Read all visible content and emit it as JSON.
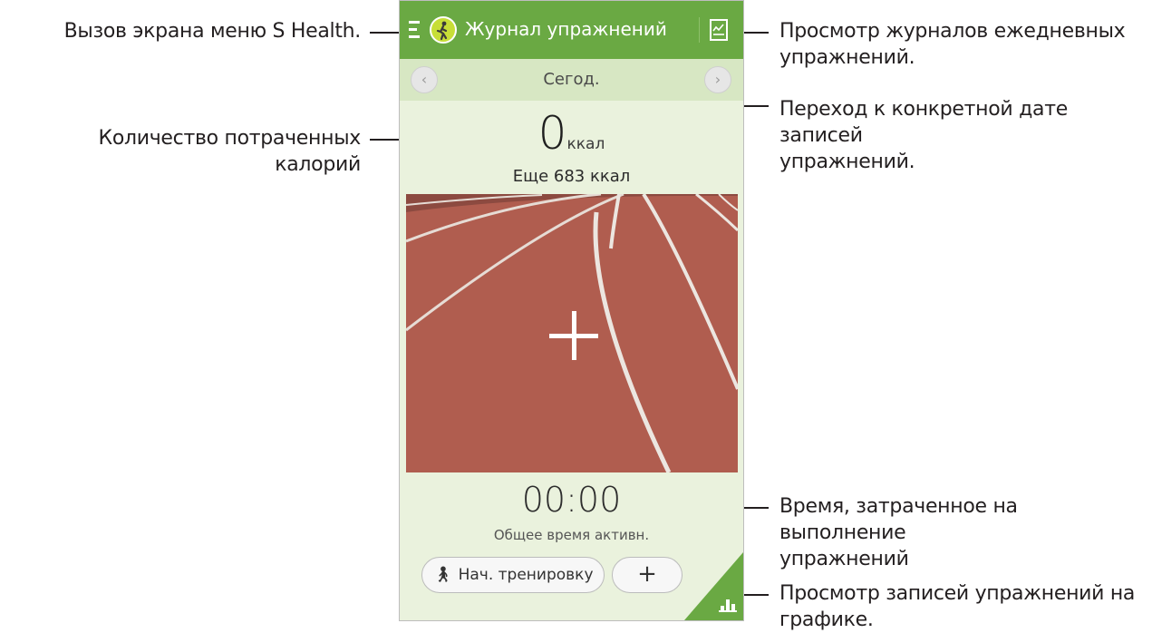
{
  "callouts": {
    "menu": "Вызов экрана меню S Health.",
    "daily_logs": [
      "Просмотр журналов ежедневных",
      "упражнений."
    ],
    "date_nav": [
      "Переход к конкретной дате записей",
      "упражнений."
    ],
    "calories": "Количество потраченных калорий",
    "time_spent": [
      "Время, затраченное на выполнение",
      "упражнений"
    ],
    "graph": [
      "Просмотр записей упражнений на",
      "графике."
    ]
  },
  "app": {
    "title": "Журнал упражнений",
    "menu_icon": "hamburger-icon",
    "logo_icon": "walker-icon",
    "log_icon": "chart-log-icon",
    "accent_color": "#6aa943"
  },
  "date_bar": {
    "label": "Сегод.",
    "prev_icon": "chevron-left-icon",
    "next_icon": "chevron-right-icon"
  },
  "calories": {
    "value": "0",
    "unit": "ккал",
    "remaining": "Еще 683 ккал"
  },
  "track": {
    "add_icon": "plus-icon"
  },
  "activity": {
    "time": "00:00",
    "label": "Общее время активн."
  },
  "buttons": {
    "start_icon": "walker-icon",
    "start_label": "Нач. тренировку",
    "add_label": "+"
  },
  "graph_button_icon": "bar-chart-icon"
}
